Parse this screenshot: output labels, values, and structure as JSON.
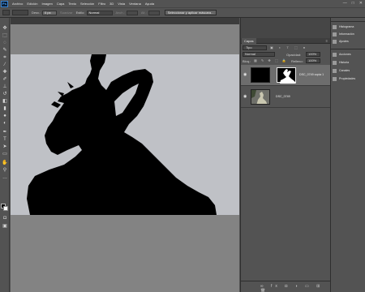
{
  "app": {
    "logo": "Ps"
  },
  "menu": [
    "Archivo",
    "Edición",
    "Imagen",
    "Capa",
    "Texto",
    "Selección",
    "Filtro",
    "3D",
    "Vista",
    "Ventana",
    "Ayuda"
  ],
  "window_controls": {
    "minimize": "—",
    "maximize": "□",
    "close": "✕"
  },
  "options": {
    "feather_label": "Desv.:",
    "feather_value": "0 px",
    "smooth_label": "Suavizar",
    "style_label": "Estilo:",
    "style_value": "Normal",
    "width_label": "Anch.:",
    "height_label": "Alt.:",
    "select_mask_button": "Seleccionar y aplicar máscara..."
  },
  "layers_panel": {
    "tab": "Capas",
    "menu_icon": "≡",
    "filter_kind": "Tipo",
    "filter_icons": "▣ ◐ T ⬚ ●",
    "blend_mode": "Normal",
    "opacity_label": "Opacidad:",
    "opacity_value": "100%",
    "lock_label": "Bloq.:",
    "lock_icons": "▦ ✎ ✥ ⬚ 🔒",
    "fill_label": "Relleno:",
    "fill_value": "100%",
    "layers": [
      {
        "name": "DSC_0749 copia 1",
        "visible": true,
        "selected": true
      },
      {
        "name": "DSC_0749",
        "visible": true,
        "selected": false
      }
    ],
    "footer_icons": "∞ fx ◘ ◑ ▭ ⊞ 🗑"
  },
  "side_panels": [
    {
      "label": "Histograma",
      "icon": "histogram-icon"
    },
    {
      "label": "Información",
      "icon": "info-icon"
    },
    {
      "label": "Ajustes",
      "icon": "adjustments-icon"
    },
    {
      "label": "Acciones",
      "icon": "actions-icon"
    },
    {
      "label": "Historia",
      "icon": "history-icon"
    },
    {
      "label": "Canales",
      "icon": "channels-icon"
    },
    {
      "label": "Propiedades",
      "icon": "properties-icon"
    }
  ],
  "colors": {
    "foreground": "#000000",
    "background": "#ffffff",
    "ui_dark": "#535353",
    "canvas_bg": "#bfc1c6"
  }
}
